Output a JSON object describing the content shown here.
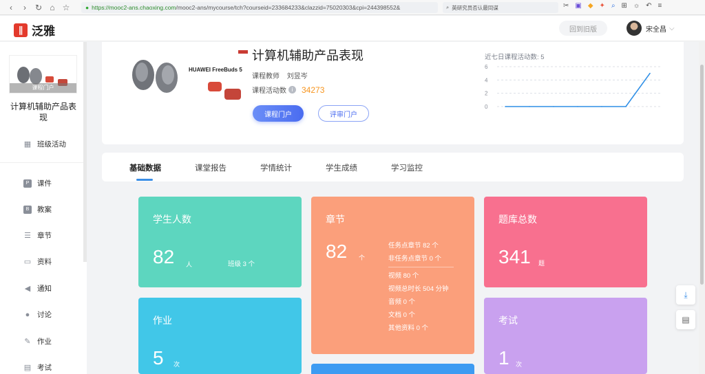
{
  "browser": {
    "url_host": "https://mooc2-ans.chaoxing.com",
    "url_path": "/mooc2-ans/mycourse/tch?courseid=233684233&clazzid=75020303&cpi=244398552&",
    "search_text": "英研究员否认最同谋"
  },
  "header": {
    "logo_text": "泛雅",
    "old_version_label": "回到旧版",
    "user_name": "宋全昌"
  },
  "sidebar": {
    "cover_label": "课程门户",
    "course_title": "计算机辅助产品表现",
    "class_activity": "班级活动",
    "items": [
      {
        "label": "课件",
        "icon": "P"
      },
      {
        "label": "教案",
        "icon": "B"
      },
      {
        "label": "章节",
        "icon": "☰"
      },
      {
        "label": "资料",
        "icon": "▭"
      },
      {
        "label": "通知",
        "icon": "◀"
      },
      {
        "label": "讨论",
        "icon": "●"
      },
      {
        "label": "作业",
        "icon": "✎"
      },
      {
        "label": "考试",
        "icon": "▤"
      }
    ]
  },
  "course": {
    "title": "计算机辅助产品表现",
    "teacher_label": "课程教师",
    "teacher_name": "刘昱岑",
    "activity_label": "课程活动数",
    "activity_count": "34273",
    "btn_course": "课程门户",
    "btn_review": "评审门户",
    "image_brand": "HUAWEI FreeBuds 5"
  },
  "chart_data": {
    "type": "line",
    "title": "近七日课程活动数: 5",
    "x": [
      1,
      2,
      3,
      4,
      5,
      6,
      7
    ],
    "values": [
      0,
      0,
      0,
      0,
      0,
      0,
      5
    ],
    "yticks": [
      0,
      2,
      4,
      6
    ],
    "ylim": [
      0,
      6
    ],
    "grid": true,
    "color": "#2f8fe6"
  },
  "tabs": [
    {
      "label": "基础数据"
    },
    {
      "label": "课堂报告"
    },
    {
      "label": "学情统计"
    },
    {
      "label": "学生成绩"
    },
    {
      "label": "学习监控"
    }
  ],
  "cards": {
    "students": {
      "title": "学生人数",
      "count": "82",
      "unit": "人",
      "extra": "班级 3 个",
      "color": "#5dd6bf"
    },
    "chapters": {
      "title": "章节",
      "count": "82",
      "unit": "个",
      "color": "#fb9f7b",
      "list1": [
        "任务点章节 82 个",
        "非任务点章节 0 个"
      ],
      "list2": [
        "视频 80 个",
        "视频总时长 504 分钟",
        "音频 0 个",
        "文档 0 个",
        "其他资料 0 个"
      ]
    },
    "questions": {
      "title": "题库总数",
      "count": "341",
      "unit": "题",
      "color": "#f8708f"
    },
    "homework": {
      "title": "作业",
      "count": "5",
      "unit": "次",
      "color": "#41c7e8"
    },
    "exams": {
      "title": "考试",
      "count": "1",
      "unit": "次",
      "color": "#c9a1ef"
    },
    "bottom_color": "#3d9bf2"
  }
}
